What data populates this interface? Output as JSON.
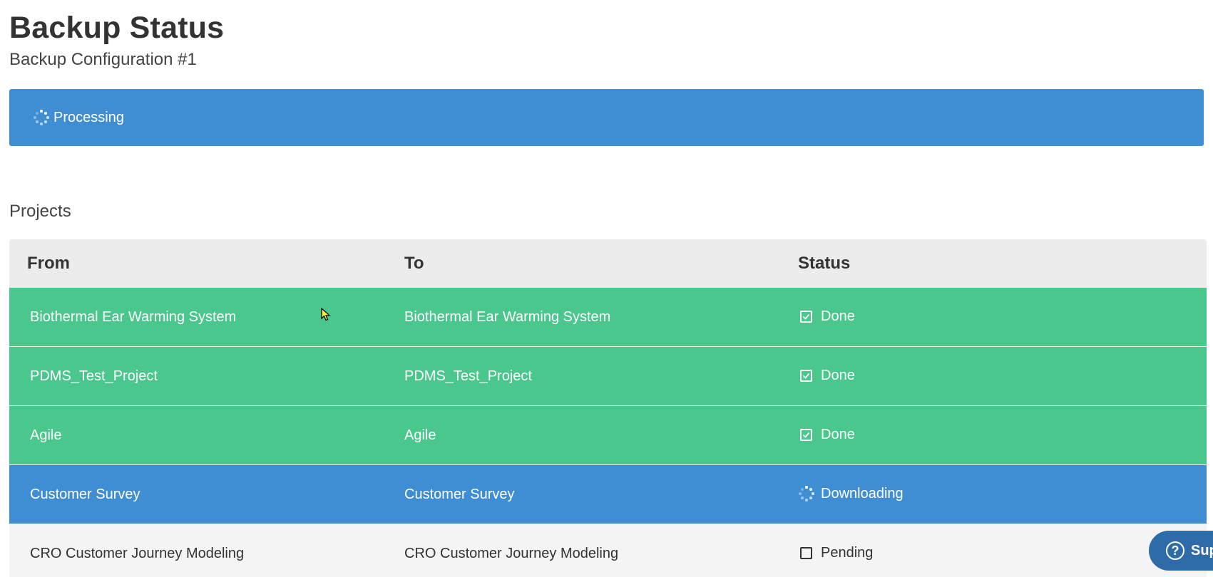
{
  "header": {
    "title": "Backup Status",
    "subtitle": "Backup Configuration #1"
  },
  "status_banner": {
    "icon": "spinner-icon",
    "text": "Processing",
    "color": "#3f8ed3"
  },
  "projects": {
    "section_title": "Projects",
    "columns": [
      "From",
      "To",
      "Status"
    ],
    "rows": [
      {
        "from": "Biothermal Ear Warming System",
        "to": "Biothermal Ear Warming System",
        "status": "Done",
        "icon": "checkbox-checked-icon",
        "state": "done"
      },
      {
        "from": "PDMS_Test_Project",
        "to": "PDMS_Test_Project",
        "status": "Done",
        "icon": "checkbox-checked-icon",
        "state": "done"
      },
      {
        "from": "Agile",
        "to": "Agile",
        "status": "Done",
        "icon": "checkbox-checked-icon",
        "state": "done"
      },
      {
        "from": "Customer Survey",
        "to": "Customer Survey",
        "status": "Downloading",
        "icon": "spinner-icon",
        "state": "active"
      },
      {
        "from": "CRO Customer Journey Modeling",
        "to": "CRO Customer Journey Modeling",
        "status": "Pending",
        "icon": "checkbox-empty-icon",
        "state": "pending"
      }
    ]
  },
  "support_widget": {
    "label": "Support",
    "icon": "question-icon"
  },
  "colors": {
    "done": "#49c78d",
    "active": "#3f8ed3",
    "pending": "#f4f4f4"
  }
}
